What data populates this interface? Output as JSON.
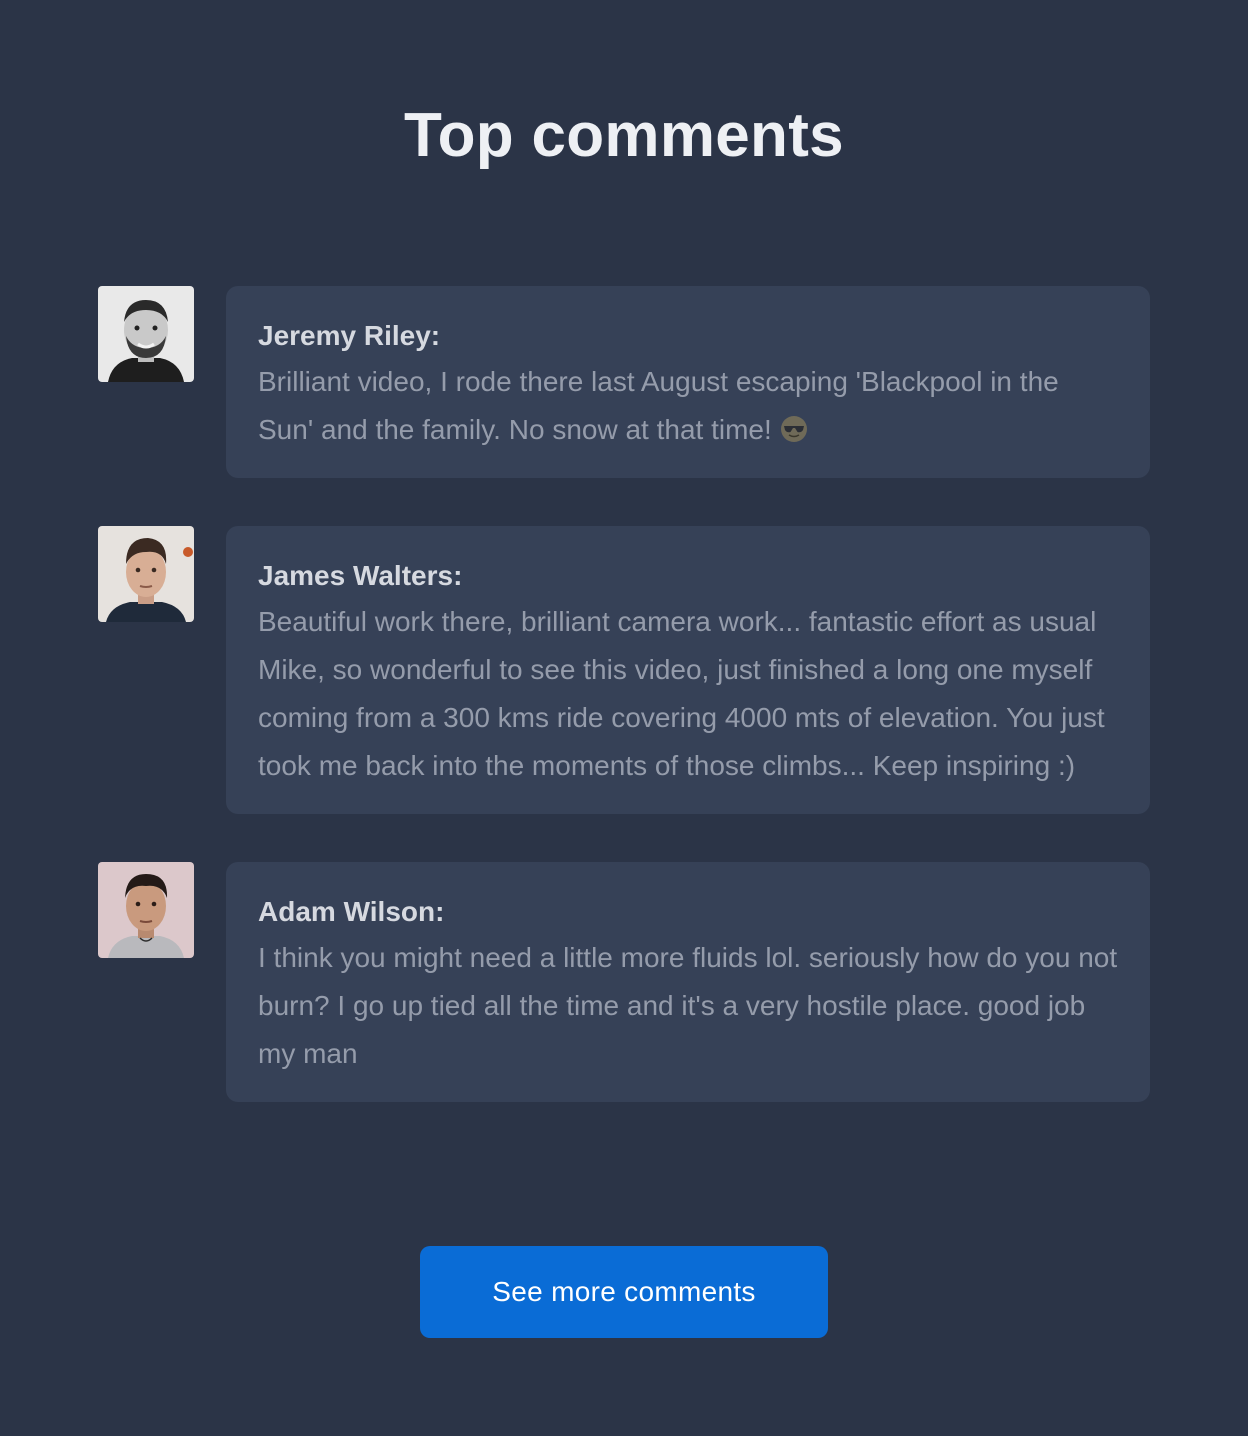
{
  "title": "Top comments",
  "comments": [
    {
      "author": "Jeremy Riley:",
      "text": "Brilliant video, I rode there last August escaping 'Blackpool in the Sun' and the family. No snow at that time!",
      "emoji": "sunglasses-emoji"
    },
    {
      "author": "James Walters:",
      "text": "Beautiful work there, brilliant camera work... fantastic effort as usual Mike, so wonderful to see this video, just finished a long one myself coming from a 300 kms ride covering 4000 mts of elevation. You just took me back into the moments of those climbs... Keep inspiring :)"
    },
    {
      "author": "Adam Wilson:",
      "text": "I think you might need a little more fluids lol. seriously how do you not burn? I go up tied all the time and it's a very hostile place. good job my man"
    }
  ],
  "button": {
    "label": "See more comments"
  },
  "colors": {
    "background": "#2b3447",
    "card": "#364157",
    "accent": "#0a6cd6"
  }
}
